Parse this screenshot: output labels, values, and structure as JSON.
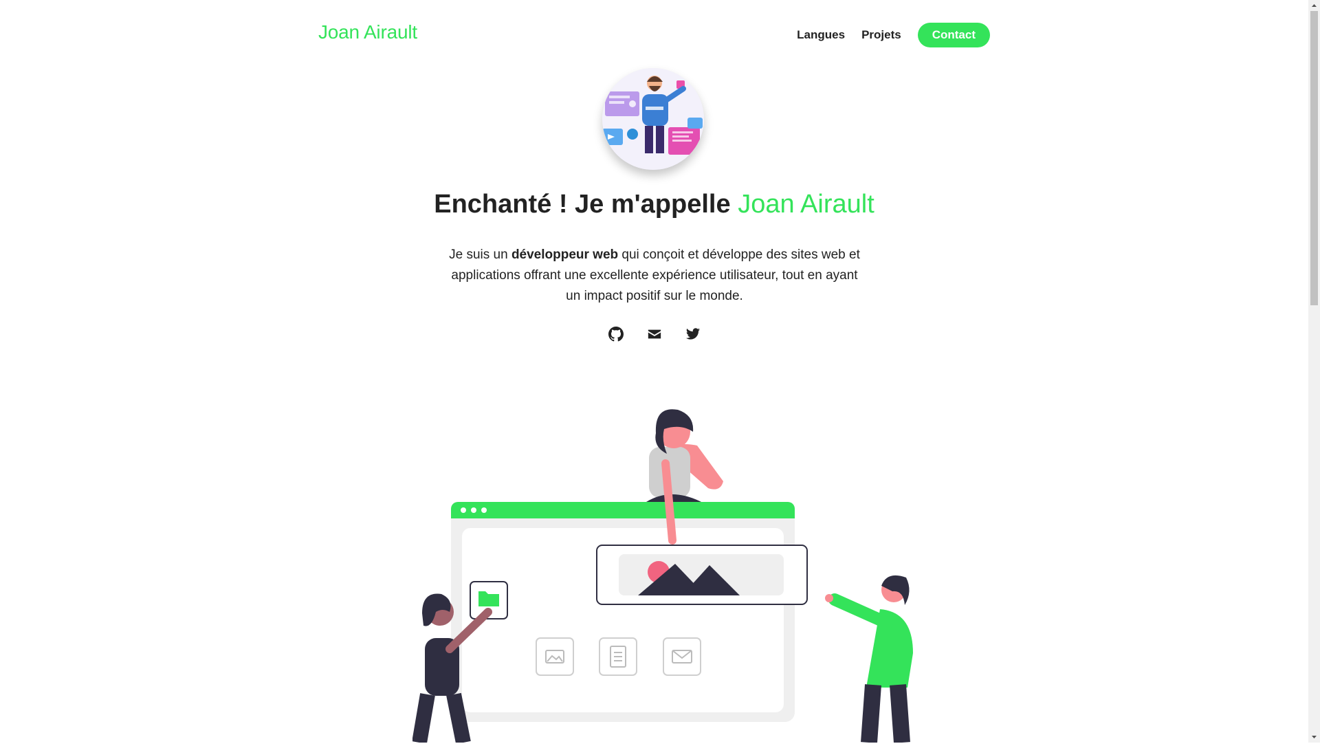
{
  "header": {
    "brand": "Joan Airault",
    "nav": [
      {
        "label": "Langues"
      },
      {
        "label": "Projets"
      }
    ],
    "contact_label": "Contact"
  },
  "hero": {
    "title_prefix": "Enchanté ! Je m'appelle ",
    "title_name": "Joan Airault",
    "text_before": "Je suis un ",
    "text_bold": "développeur web",
    "text_after": " qui conçoit et développe des sites web et applications offrant une excellente expérience utilisateur, tout en ayant un impact positif sur le monde."
  },
  "socials": [
    {
      "icon": "github-icon"
    },
    {
      "icon": "mail-icon"
    },
    {
      "icon": "twitter-icon"
    }
  ],
  "colors": {
    "accent": "#34e35a",
    "text": "#222222",
    "illustration_dark": "#2f2e41",
    "illustration_pink": "#f88d92"
  }
}
